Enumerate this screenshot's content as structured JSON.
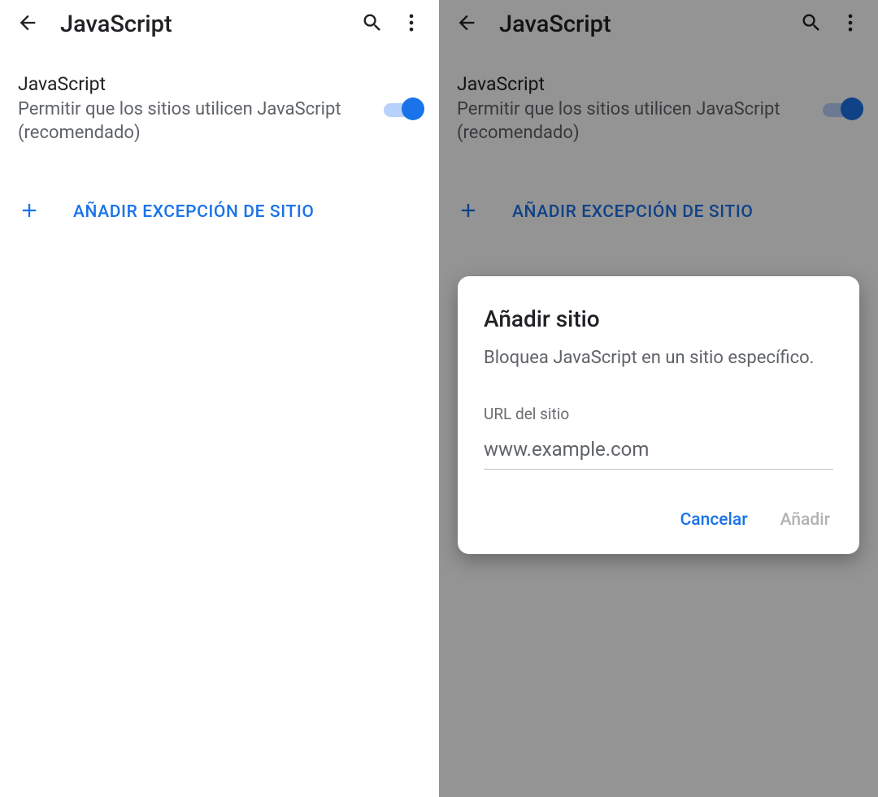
{
  "colors": {
    "accent": "#1a73e8",
    "text_primary": "#202124",
    "text_secondary": "#5f6368"
  },
  "header": {
    "title": "JavaScript"
  },
  "setting": {
    "title": "JavaScript",
    "description": "Permitir que los sitios utilicen JavaScript (recomendado)",
    "toggle_on": true
  },
  "add_exception": {
    "label": "AÑADIR EXCEPCIÓN DE SITIO"
  },
  "dialog": {
    "title": "Añadir sitio",
    "description": "Bloquea JavaScript en un sitio específico.",
    "field_label": "URL del sitio",
    "placeholder": "www.example.com",
    "value": "",
    "cancel_label": "Cancelar",
    "add_label": "Añadir"
  }
}
